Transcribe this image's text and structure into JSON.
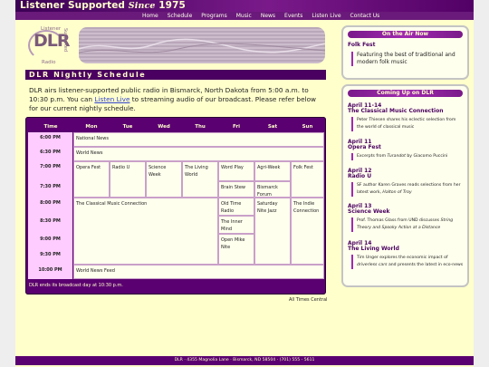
{
  "brand": {
    "title": "Listener Supported",
    "since": "Since",
    "year": "1975"
  },
  "nav": [
    "Home",
    "Schedule",
    "Programs",
    "Music",
    "News",
    "Events",
    "Listen Live",
    "Contact Us"
  ],
  "logo": {
    "top": "Listener",
    "letters": "DLR",
    "side": "Supported",
    "bottom": "Radio"
  },
  "section_title": "DLR Nightly Schedule",
  "intro": {
    "before": "DLR airs listener-supported public radio in Bismarck, North Dakota from 5:00 a.m. to 10:30 p.m. You can ",
    "link": "Listen Live",
    "after": " to streaming audio of our broadcast. Please refer below for our current nightly schedule."
  },
  "schedule": {
    "headers": [
      "Time",
      "Mon",
      "Tue",
      "Wed",
      "Thu",
      "Fri",
      "Sat",
      "Sun"
    ],
    "times": [
      "6:00 PM",
      "6:30 PM",
      "7:00 PM",
      "7:30 PM",
      "8:00 PM",
      "8:30 PM",
      "9:00 PM",
      "9:30 PM",
      "10:00 PM"
    ],
    "programs": {
      "national_news": "National News",
      "world_news": "World News",
      "opera_fest": "Opera Fest",
      "radio_u": "Radio U",
      "science_week": "Science Week",
      "living_world": "The Living World",
      "word_play": "Word Play",
      "agri_week": "Agri-Week",
      "folk_fest": "Folk Fest",
      "brain_stew": "Brain Stew",
      "bismarck_forum": "Bismarck Forum",
      "classical": "The Classical Music Connection",
      "old_time_radio": "Old Time Radio",
      "saturday_jazz": "Saturday Nite Jazz",
      "indie": "The Indie Connection",
      "inner_mind": "The Inner Mind",
      "open_mike": "Open Mike Nite",
      "world_news_feed": "World News Feed"
    },
    "footer": "DLR ends its broadcast day at 10:30 p.m."
  },
  "timezone_note": "All Times Central",
  "on_air": {
    "title": "On the Air Now",
    "show": "Folk Fest",
    "description": "Featuring the best of traditional and modern folk music"
  },
  "coming_up": {
    "title": "Coming Up on DLR",
    "events": [
      {
        "date": "April 11-14",
        "name": "The Classical Music Connection",
        "desc": "Peter Thiesen shares his eclectic selection from the world of classical music"
      },
      {
        "date": "April 11",
        "name": "Opera Fest",
        "desc_before": "Excerpts from ",
        "desc_em": "Turandot",
        "desc_after": " by Giacomo Puccini"
      },
      {
        "date": "April 12",
        "name": "Radio U",
        "desc_before": "SF author Karen Graves reads selections from her latest work, ",
        "desc_em": "Halton of Troy",
        "desc_after": ""
      },
      {
        "date": "April 13",
        "name": "Science Week",
        "desc_before": "Prof. Thomas Glass from UND discusses ",
        "desc_em": "String Theory and Spooky Action at a Distance",
        "desc_after": ""
      },
      {
        "date": "April 14",
        "name": "The Living World",
        "desc_before": "Tim Unger explores the economic impact of ",
        "desc_em": "driverless cars",
        "desc_after": " and presents the latest in eco-news"
      }
    ]
  },
  "footer": "DLR · 4355 Magnolia Lane · Bismarck, ND 58504 · (701) 555 - 5611",
  "colors": {
    "accent": "#5a0070",
    "page_bg": "#ffffcc",
    "highlight": "#ffccff"
  }
}
